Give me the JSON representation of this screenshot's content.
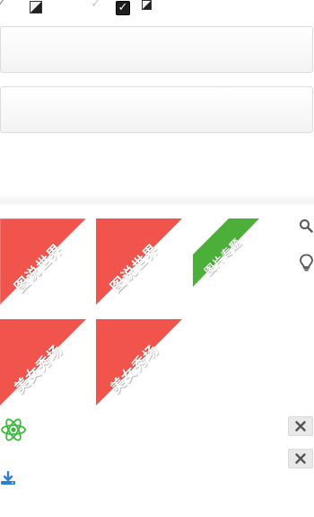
{
  "top_icons": {
    "check_left": "✓",
    "check_mid": "✓",
    "checked_box": "✓"
  },
  "ribbons": [
    {
      "label": "图说世界",
      "color": "#f0544d"
    },
    {
      "label": "图说世界",
      "color": "#f0544d"
    },
    {
      "label": "图片专题",
      "color": "#4caf3a"
    },
    {
      "label": "美女秀场",
      "color": "#f0544d"
    },
    {
      "label": "美女秀场",
      "color": "#f0544d"
    }
  ],
  "colors": {
    "ribbon_red": "#f0544d",
    "ribbon_green": "#4caf3a",
    "atom_green": "#3cb83c",
    "download_blue": "#2a7fd1",
    "icon_gray": "#555555"
  },
  "icons": {
    "search": "search-icon",
    "bulb": "lightbulb-icon",
    "atom": "atom-icon",
    "close": "close-icon",
    "download": "download-icon"
  }
}
